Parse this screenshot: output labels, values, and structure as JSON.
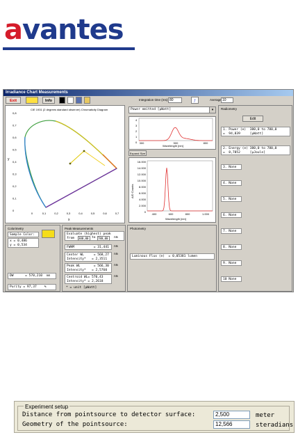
{
  "logo": {
    "text": "avantes"
  },
  "window": {
    "title": "Irradiance Chart Measurements",
    "toolbar": {
      "exit_label": "Exit",
      "info_label": "Info",
      "integration_label": "Integration time (ms):",
      "integration_value": "80",
      "average_label": "Average",
      "average_value": "10"
    },
    "cie": {
      "title": "CIE 1931 (2 degrees standard observer) Chromaticity Diagram",
      "y_axis_label": "y",
      "x_axis_label": "x",
      "y_ticks": [
        "0,8",
        "0,7",
        "0,6",
        "0,5",
        "0,4",
        "0,3",
        "0,2",
        "0,1",
        "0"
      ],
      "x_ticks": [
        "0",
        "0,1",
        "0,2",
        "0,3",
        "0,4",
        "0,5",
        "0,6",
        "0,7"
      ]
    },
    "power_select": "Power emitted      [µWatt]",
    "small_chart": {
      "y_ticks": [
        "4",
        "3",
        "2",
        "1",
        "0"
      ],
      "x_ticks": [
        "300",
        "500",
        "800"
      ],
      "xlabel": "Wavelength [nm]",
      "expand_label": "Expand Size"
    },
    "big_chart": {
      "ylabel": "A/D Counts",
      "y_ticks": [
        "16.000",
        "14.000",
        "12.000",
        "10.000",
        "8.000",
        "6.000",
        "4.000",
        "2.000",
        "0"
      ],
      "x_ticks": [
        "400",
        "600",
        "800",
        "1.000"
      ],
      "xlabel": "Wavelength [nm]"
    },
    "radiometry": {
      "title": "Radiometry",
      "edit_label": "Edit",
      "items": [
        "1. Power (e)  380,0 to 780,0\n=  94,839     [µWatt]",
        "2. Energy (e) 380,0 to 780,0\n=  8,7852     [µJoule]",
        "3. None",
        "4. None",
        "5. None",
        "6. None",
        "7. None",
        "8. None",
        "9. None",
        "10 None"
      ]
    },
    "colorimetry": {
      "title": "Colorimetry",
      "sample_color_label": "Sample Color:",
      "sample_color": "#f5dd1a",
      "xy": "x = 0,486\ny = 0,534",
      "dw": "DW      = 570,210  nm",
      "purity": "Purity = 97,37    %"
    },
    "peak": {
      "title": "Peak Measurements",
      "evaluate_label": "Evaluate (highest) peak\nfrom",
      "from_value": "300,00",
      "to_label": "to",
      "to_value": "780,00",
      "nm": "nm",
      "fwhm": "FWHM          = 31,441",
      "center": "Center WL     = 568,27\nIntensity*   = 2,3511",
      "peak_wl": "Peak WL       = 566,30\nIntensity*   = 2,5760",
      "centroid": "Centroid WL= 570,43\nIntensity* = 2,2618",
      "footnote": "* = unit [µWatt]"
    },
    "photometry": {
      "title": "Photometry",
      "flux": "Luminous Flux (e)  = 0,05381 lumen"
    }
  },
  "experiment": {
    "legend": "Experiment setup",
    "distance_label": "Distance from pointsource to detector surface:",
    "distance_value": "2,500",
    "distance_unit": "meter",
    "geometry_label": "Geometry of the pointsource:",
    "geometry_value": "12,566",
    "geometry_unit": "steradians"
  }
}
